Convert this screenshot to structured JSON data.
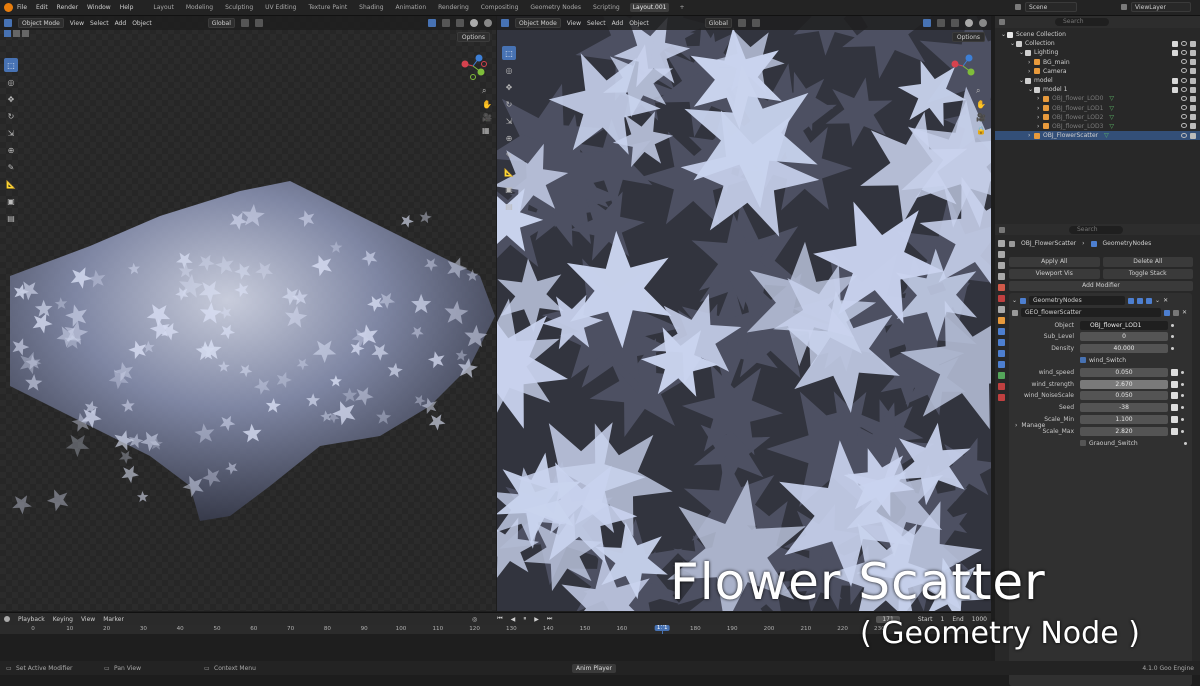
{
  "topbar": {
    "menus": [
      "File",
      "Edit",
      "Render",
      "Window",
      "Help"
    ],
    "workspaces": [
      "Layout",
      "Modeling",
      "Sculpting",
      "UV Editing",
      "Texture Paint",
      "Shading",
      "Animation",
      "Rendering",
      "Compositing",
      "Geometry Nodes",
      "Scripting",
      "Layout.001"
    ],
    "active_workspace": "Layout.001",
    "add_tab": "+",
    "scene": "Scene",
    "view_layer": "ViewLayer"
  },
  "viewport_left": {
    "mode": "Object Mode",
    "menus": [
      "View",
      "Select",
      "Add",
      "Object"
    ],
    "orientation": "Global",
    "options": "Options"
  },
  "viewport_right": {
    "mode": "Object Mode",
    "menus": [
      "View",
      "Select",
      "Add",
      "Object"
    ],
    "orientation": "Global",
    "options": "Options"
  },
  "outliner": {
    "search_placeholder": "Search",
    "items": [
      {
        "label": "Scene Collection",
        "depth": 0,
        "kind": "collection"
      },
      {
        "label": "Collection",
        "depth": 1,
        "kind": "collection"
      },
      {
        "label": "Lighting",
        "depth": 2,
        "kind": "collection"
      },
      {
        "label": "BG_main",
        "depth": 3,
        "kind": "light"
      },
      {
        "label": "Camera",
        "depth": 3,
        "kind": "camera"
      },
      {
        "label": "model",
        "depth": 2,
        "kind": "collection"
      },
      {
        "label": "model 1",
        "depth": 3,
        "kind": "collection"
      },
      {
        "label": "OBJ_flower_LOD0",
        "depth": 4,
        "kind": "mesh-disabled"
      },
      {
        "label": "OBJ_flower_LOD1",
        "depth": 4,
        "kind": "mesh-disabled"
      },
      {
        "label": "OBJ_flower_LOD2",
        "depth": 4,
        "kind": "mesh-disabled"
      },
      {
        "label": "OBJ_flower_LOD3",
        "depth": 4,
        "kind": "mesh-disabled"
      },
      {
        "label": "OBJ_FlowerScatter",
        "depth": 3,
        "kind": "mesh"
      }
    ]
  },
  "properties": {
    "search_placeholder": "Search",
    "breadcrumb_object": "OBJ_FlowerScatter",
    "breadcrumb_modifier": "GeometryNodes",
    "apply_all": "Apply All",
    "delete_all": "Delete All",
    "viewport_vis": "Viewport Vis",
    "toggle_stack": "Toggle Stack",
    "add_modifier": "Add Modifier",
    "modifier_name": "GeometryNodes",
    "node_group": "GEO_flowerScatter",
    "fields": [
      {
        "label": "Object",
        "value": "OBJ_flower_LOD1",
        "type": "object"
      },
      {
        "label": "Sub_Level",
        "value": "0",
        "type": "number"
      },
      {
        "label": "Density",
        "value": "40.000",
        "type": "number"
      },
      {
        "label": "wind_Switch",
        "value": "checked",
        "type": "checkbox"
      },
      {
        "label": "wind_speed",
        "value": "0.050",
        "type": "number"
      },
      {
        "label": "wind_strength",
        "value": "2.670",
        "type": "number-selected"
      },
      {
        "label": "wind_NoiseScale",
        "value": "0.050",
        "type": "number"
      },
      {
        "label": "Seed",
        "value": "-38",
        "type": "number"
      },
      {
        "label": "Scale_Min",
        "value": "1.100",
        "type": "number"
      },
      {
        "label": "Scale_Max",
        "value": "2.820",
        "type": "number"
      },
      {
        "label": "Graound_Switch",
        "value": "unchecked",
        "type": "checkbox"
      }
    ],
    "manage": "Manage"
  },
  "timeline": {
    "menus": [
      "Playback",
      "Keying",
      "View",
      "Marker"
    ],
    "current_frame": "171",
    "start_label": "Start",
    "start_value": "1",
    "end_label": "End",
    "end_value": "1000",
    "ticks": [
      "0",
      "10",
      "20",
      "30",
      "40",
      "50",
      "60",
      "70",
      "80",
      "90",
      "100",
      "110",
      "120",
      "130",
      "140",
      "150",
      "160",
      "171",
      "180",
      "190",
      "200",
      "210",
      "220",
      "230"
    ]
  },
  "statusbar": {
    "items": [
      "Set Active Modifier",
      "Pan View",
      "Context Menu"
    ],
    "center": "Anim Player",
    "version": "4.1.0 Goo Engine"
  },
  "overlay": {
    "title": "Flower Scatter",
    "subtitle": "( Geometry Node )"
  },
  "colors": {
    "accent": "#4772b3",
    "panel": "#282828",
    "flower": "#c9d3ee"
  }
}
